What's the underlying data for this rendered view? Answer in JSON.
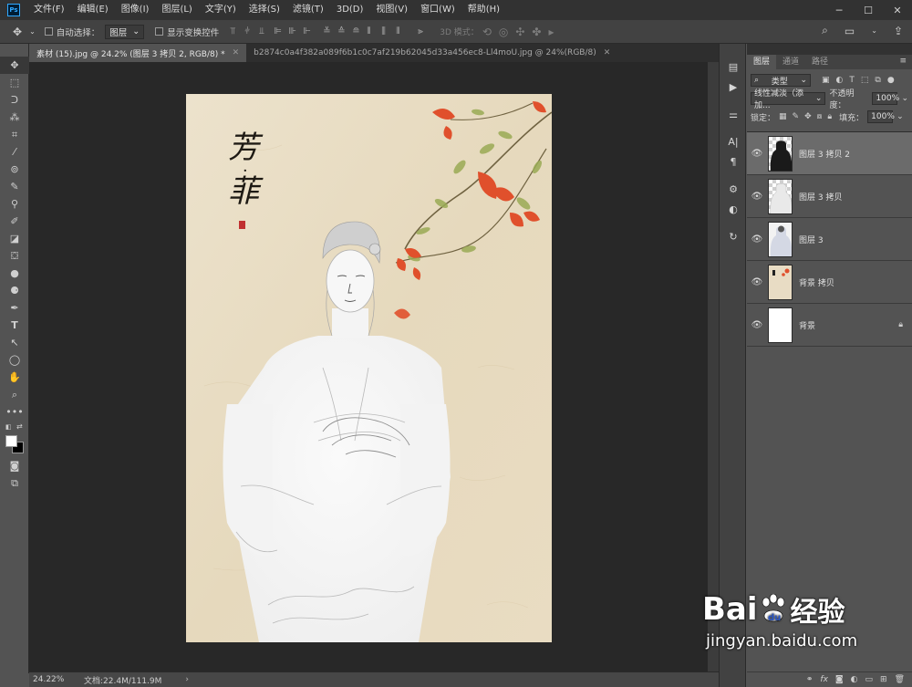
{
  "app": {
    "logo": "Ps"
  },
  "menu": [
    "文件(F)",
    "编辑(E)",
    "图像(I)",
    "图层(L)",
    "文字(Y)",
    "选择(S)",
    "滤镜(T)",
    "3D(D)",
    "视图(V)",
    "窗口(W)",
    "帮助(H)"
  ],
  "window_controls": {
    "minimize": "─",
    "maximize": "☐",
    "close": "✕"
  },
  "options": {
    "auto_select_label": "自动选择：",
    "auto_select_target": "图层",
    "show_transform_label": "显示变换控件",
    "mode_3d_label": "3D 模式："
  },
  "tabs": [
    {
      "title": "素材 (15).jpg @ 24.2% (图层 3 拷贝 2, RGB/8) *",
      "close": "✕"
    },
    {
      "title": "b2874c0a4f382a089f6b1c0c7af219b62045d33a456ec8-Ll4moU.jpg @ 24%(RGB/8)",
      "close": "✕"
    }
  ],
  "document": {
    "calligraphy_top": "芳",
    "calligraphy_bottom": "菲",
    "calligraphy_dot": "·",
    "colors": {
      "paper": "#e8dcc4",
      "flower": "#e0502c",
      "leaf": "#9aab55",
      "seal": "#c03030"
    }
  },
  "status": {
    "zoom": "24.22%",
    "doc_info": "文档:22.4M/111.9M",
    "arrow": "›"
  },
  "layers_panel": {
    "tabs": [
      "图层",
      "通道",
      "路径"
    ],
    "menu_icon": "≡",
    "filter_kind": "类型",
    "blend_mode": "线性减淡（添加...",
    "opacity_label": "不透明度：",
    "opacity_value": "100%",
    "lock_label": "锁定：",
    "fill_label": "填充：",
    "fill_value": "100%",
    "layers": [
      {
        "name": "图层 3 拷贝 2",
        "selected": true,
        "thumb": "dark",
        "locked": false
      },
      {
        "name": "图层 3 拷贝",
        "selected": false,
        "thumb": "sketch",
        "locked": false
      },
      {
        "name": "图层 3",
        "selected": false,
        "thumb": "figure",
        "locked": false
      },
      {
        "name": "背景 拷贝",
        "selected": false,
        "thumb": "paper",
        "locked": false
      },
      {
        "name": "背景",
        "selected": false,
        "thumb": "white",
        "locked": true
      }
    ],
    "footer_icons": [
      "link-icon",
      "fx-icon",
      "mask-icon",
      "adjustment-icon",
      "folder-icon",
      "new-layer-icon",
      "trash-icon"
    ],
    "footer_fx": "fx"
  },
  "watermark": {
    "brand_a": "Bai",
    "brand_b": "du",
    "brand_cn": "经验",
    "url": "jingyan.baidu.com"
  }
}
